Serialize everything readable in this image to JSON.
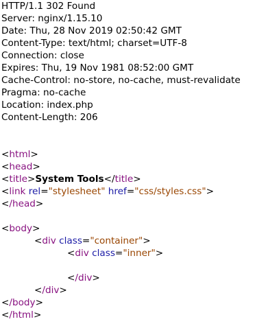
{
  "colors": {
    "tag": "#881280",
    "attribute": "#1a1aa6",
    "value": "#994500",
    "text": "#000000",
    "background": "#ffffff"
  },
  "headers": [
    "HTTP/1.1 302 Found",
    "Server: nginx/1.15.10",
    "Date: Thu, 28 Nov 2019 02:50:42 GMT",
    "Content-Type: text/html; charset=UTF-8",
    "Connection: close",
    "Expires: Thu, 19 Nov 1981 08:52:00 GMT",
    "Cache-Control: no-store, no-cache, must-revalidate",
    "Pragma: no-cache",
    "Location: index.php",
    "Content-Length: 206"
  ],
  "source": {
    "html_open": "html",
    "head_open": "head",
    "title_tag": "title",
    "title_text": "System Tools",
    "link_tag": "link",
    "link_rel_attr": "rel",
    "link_rel_val": "\"stylesheet\"",
    "link_href_attr": "href",
    "link_href_val": "\"css/styles.css\"",
    "head_close": "/head",
    "body_open": "body",
    "div_tag": "div",
    "class_attr": "class",
    "container_val": "\"container\"",
    "inner_val": "\"inner\"",
    "div_close": "/div",
    "body_close": "/body",
    "html_close": "/html"
  }
}
